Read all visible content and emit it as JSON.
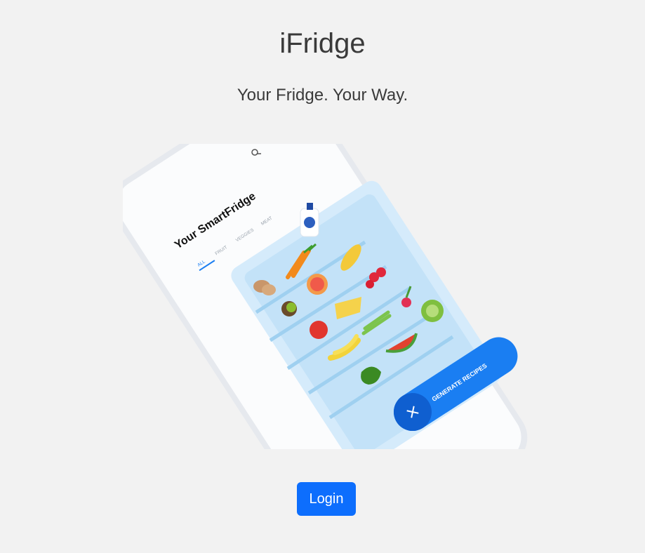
{
  "header": {
    "title": "iFridge",
    "tagline": "Your Fridge. Your Way."
  },
  "hero": {
    "app_name": "Your SmartFridge",
    "tabs": [
      "ALL",
      "FRUIT",
      "VEGGIES",
      "MEAT"
    ],
    "active_tab": "ALL",
    "cta_label": "GENERATE RECIPES",
    "accent": "#1a7ef2"
  },
  "actions": {
    "login_label": "Login"
  },
  "colors": {
    "background": "#f2f2f2",
    "primary": "#0d6efd",
    "heading": "#3a3a3a"
  }
}
